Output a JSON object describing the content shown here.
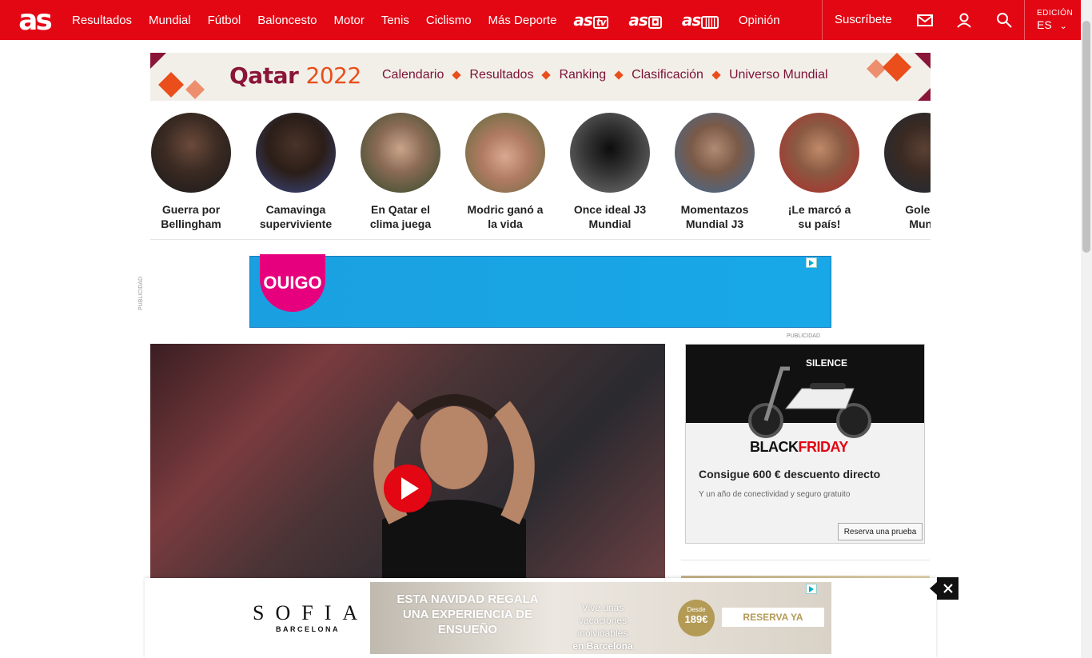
{
  "header": {
    "logo": "as",
    "nav": [
      "Resultados",
      "Mundial",
      "Fútbol",
      "Baloncesto",
      "Motor",
      "Tenis",
      "Ciclismo",
      "Más Deporte"
    ],
    "brands": [
      {
        "text": "as",
        "suffix": "tv"
      },
      {
        "text": "as",
        "suffix": "📷"
      },
      {
        "text": "as",
        "suffix": "|||"
      }
    ],
    "opinion": "Opinión",
    "subscribe": "Suscríbete",
    "edition_label": "EDICIÓN",
    "edition_value": "ES"
  },
  "qatar": {
    "title": "Qatar",
    "year": "2022",
    "links": [
      "Calendario",
      "Resultados",
      "Ranking",
      "Clasificación",
      "Universo Mundial"
    ]
  },
  "stories": [
    {
      "line1": " Guerra por",
      "line2": "Bellingham"
    },
    {
      "line1": "Camavinga",
      "line2": "superviviente"
    },
    {
      "line1": "En Qatar el",
      "line2": "clima juega"
    },
    {
      "line1": "Modric ganó a",
      "line2": "la vida"
    },
    {
      "line1": "Once ideal J3",
      "line2": "Mundial"
    },
    {
      "line1": "Momentazos",
      "line2": "Mundial J3"
    },
    {
      "line1": "¡Le marcó a",
      "line2": "su país!"
    },
    {
      "line1": " Golead",
      "line2": "Mund"
    }
  ],
  "ads": {
    "publicidad": "PUBLICIDAD",
    "ouigo": "OUIGO",
    "silence_brand": "SILENCE",
    "silence_bf_black": "BLACK",
    "silence_bf_friday": "FRIDAY",
    "silence_title": "Consigue 600 € descuento directo",
    "silence_sub": "Y un año de conectividad y seguro gratuito",
    "silence_btn": "Reserva una prueba",
    "sofia": "SOFIA",
    "sofia_sub": "BARCELONA",
    "navidad": "ESTA NAVIDAD REGALA UNA EXPERIENCIA DE ENSUEÑO",
    "vacaciones": "Vive unas vacaciones inolvidables",
    "vacaciones_city": "en Barcelona",
    "desde": "Desde",
    "price": "189€",
    "reserva": "RESERVA YA"
  },
  "colors": {
    "brand_red": "#e30613",
    "qatar_maroon": "#8a1538",
    "qatar_orange": "#e94e1b"
  }
}
